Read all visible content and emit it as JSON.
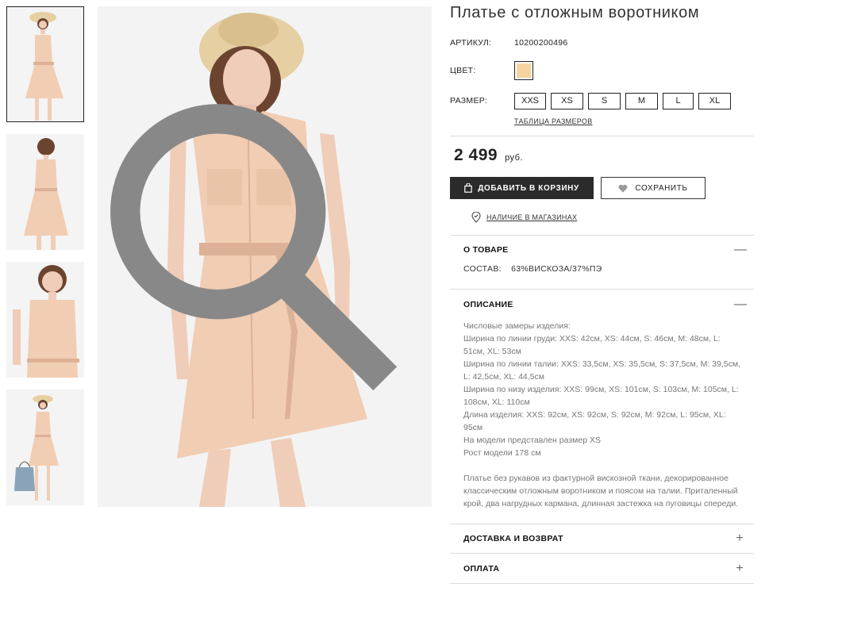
{
  "product": {
    "title": "Платье с отложным воротником",
    "article_label": "АРТИКУЛ:",
    "article_value": "10200200496",
    "color_label": "ЦВЕТ:",
    "color_swatch": "#f7d39f",
    "size_label": "РАЗМЕР:",
    "sizes": [
      "XXS",
      "XS",
      "S",
      "M",
      "L",
      "XL"
    ],
    "size_table_link": "ТАБЛИЦА РАЗМЕРОВ",
    "price": "2 499",
    "currency": "руб.",
    "add_to_cart": "ДОБАВИТЬ В КОРЗИНУ",
    "save": "СОХРАНИТЬ",
    "store_availability": "НАЛИЧИЕ В МАГАЗИНАХ"
  },
  "sections": {
    "about": {
      "title": "О ТОВАРЕ",
      "toggle": "—",
      "composition_label": "СОСТАВ:",
      "composition_value": "63%ВИСКОЗА/37%ПЭ"
    },
    "description": {
      "title": "ОПИСАНИЕ",
      "toggle": "—",
      "lines": [
        "Числовые замеры изделия:",
        "Ширина по линии груди: XXS: 42см, XS: 44см, S: 46см, M: 48см, L: 51см, XL: 53см",
        "Ширина по линии талии: XXS: 33,5см, XS: 35,5см, S: 37,5см, M: 39,5см, L: 42,5см, XL: 44,5см",
        "Ширина по низу изделия: XXS: 99см, XS: 101см, S: 103см, M: 105см, L: 108см, XL: 110см",
        "Длина изделия: XXS: 92см, XS: 92см, S: 92см, M: 92см, L: 95см, XL: 95см",
        "На модели представлен размер XS",
        "Рост модели 178 см"
      ],
      "paragraph": "Платье без рукавов из фактурной вискозной ткани, декорированное классическим отложным воротником и поясом на талии. Приталенный крой, два нагрудных кармана, длинная застежка на пуговицы спереди."
    },
    "delivery": {
      "title": "ДОСТАВКА И ВОЗВРАТ",
      "toggle": "+"
    },
    "payment": {
      "title": "ОПЛАТА",
      "toggle": "+"
    }
  },
  "colors": {
    "dress": "#f1cdb3",
    "dress_shadow": "#ddb197",
    "hat": "#e6cfa2",
    "hair": "#6b4430",
    "skin": "#efcdb8",
    "bag": "#8aa3b8",
    "background": "#f3f3f3",
    "button_dark": "#2b2b2b"
  },
  "icons": [
    "zoom-icon",
    "bag-icon",
    "heart-icon",
    "location-pin-icon",
    "minus-icon",
    "plus-icon"
  ]
}
